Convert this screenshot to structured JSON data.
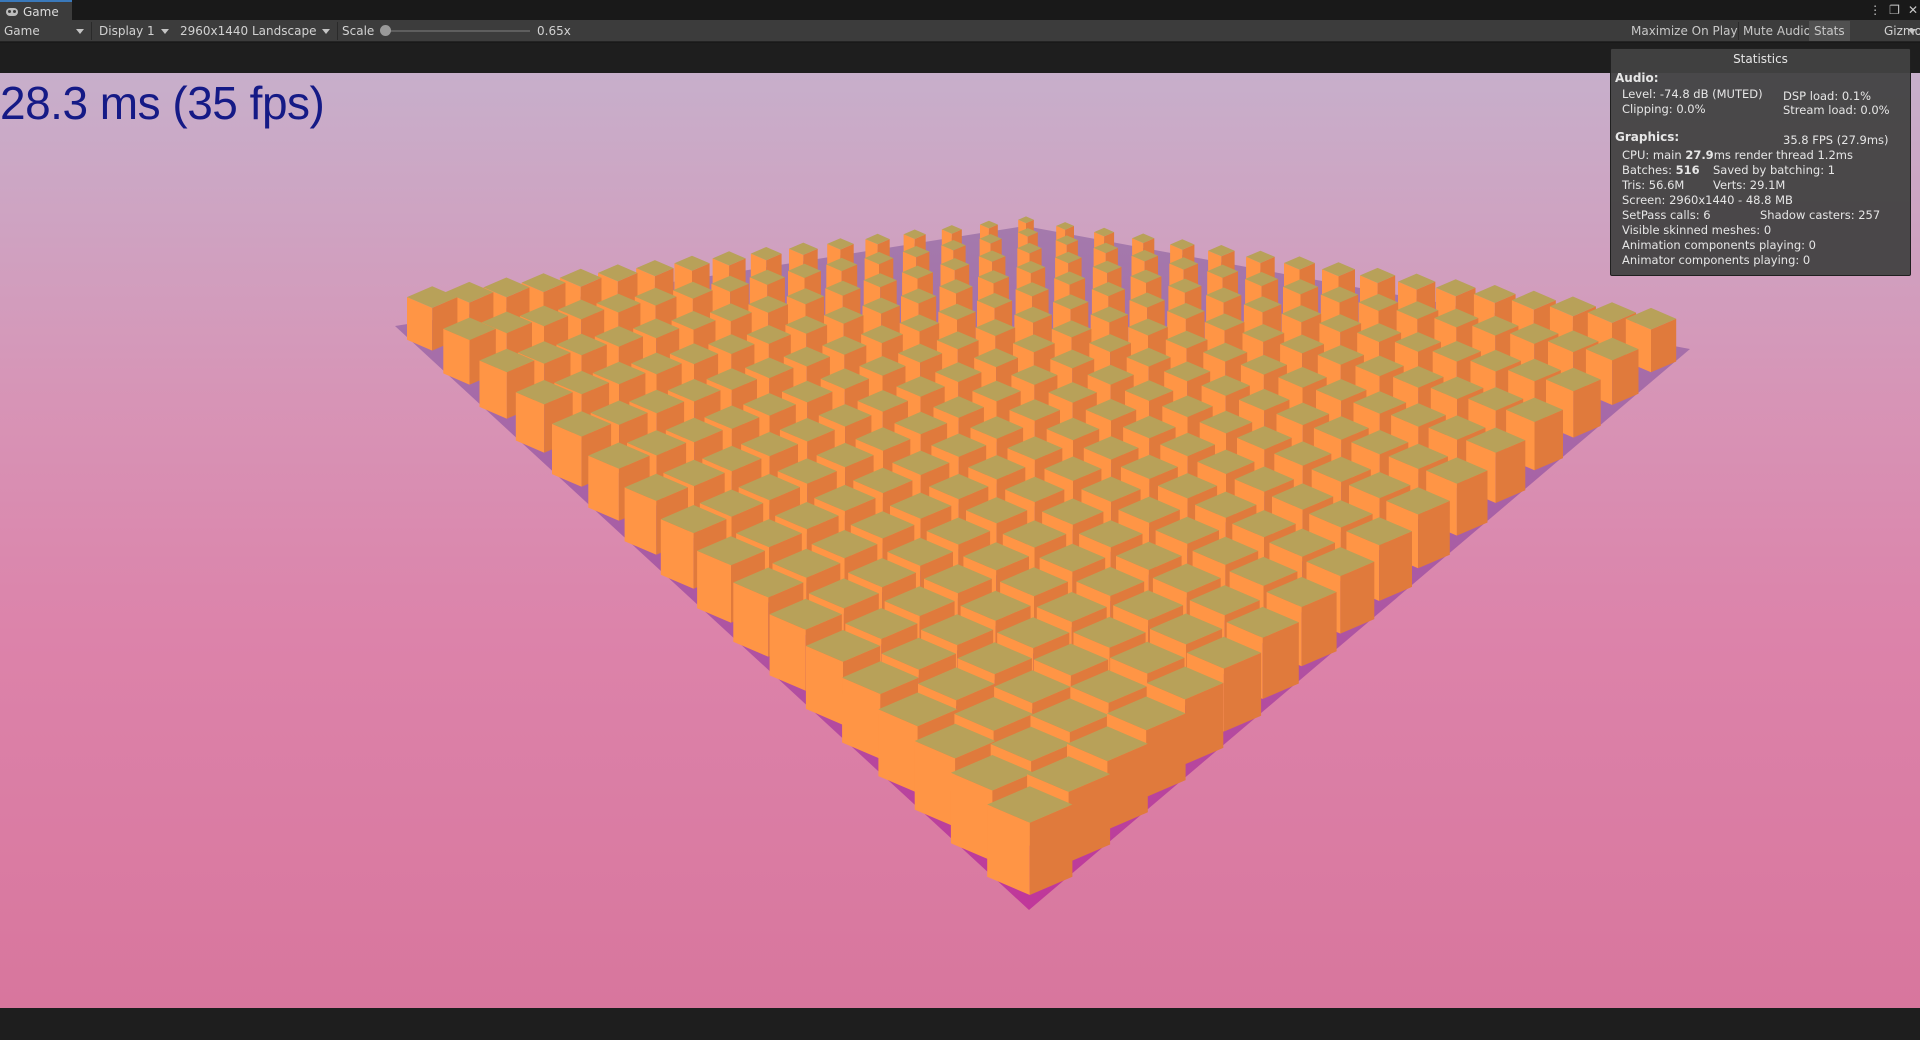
{
  "tab": {
    "label": "Game"
  },
  "window_controls": {
    "menu": "⋮",
    "maximize": "❐",
    "close": "✕"
  },
  "toolbar": {
    "view_dropdown": "Game",
    "display_dropdown": "Display 1",
    "resolution_dropdown": "2960x1440 Landscape",
    "scale_label": "Scale",
    "scale_value": "0.65x",
    "scale_level": 0.0,
    "maximize_on_play": "Maximize On Play",
    "mute_audio": "Mute Audio",
    "stats": "Stats",
    "gizmos": "Gizmos"
  },
  "viewport": {
    "fps_text": "28.3 ms (35 fps)"
  },
  "stats": {
    "title": "Statistics",
    "audio_heading": "Audio:",
    "level": "Level: -74.8 dB (MUTED)",
    "dsp_load": "DSP load: 0.1%",
    "clipping": "Clipping: 0.0%",
    "stream_load": "Stream load: 0.0%",
    "graphics_heading": "Graphics:",
    "fps": "35.8 FPS (27.9ms)",
    "cpu_prefix": "CPU: main ",
    "cpu_main": "27.9",
    "cpu_suffix": "ms  render thread 1.2ms",
    "batches_prefix": "Batches: ",
    "batches": "516",
    "saved_by_batching": "Saved by batching: 1",
    "tris": "Tris: 56.6M",
    "verts": "Verts: 29.1M",
    "screen": "Screen: 2960x1440 - 48.8 MB",
    "setpass": "SetPass calls: 6",
    "shadow_casters": "Shadow casters: 257",
    "visible_skinned": "Visible skinned meshes: 0",
    "animation_components": "Animation components playing: 0",
    "animator_components": "Animator components playing: 0"
  },
  "colors": {
    "cube_top": "#b8a159",
    "cube_left": "#ff9545",
    "cube_right": "#e07a3c",
    "ground": "#b94a9c",
    "fps_text": "#151a86",
    "tab_accent": "#3a79bb"
  },
  "scene": {
    "grid_size": 17
  }
}
